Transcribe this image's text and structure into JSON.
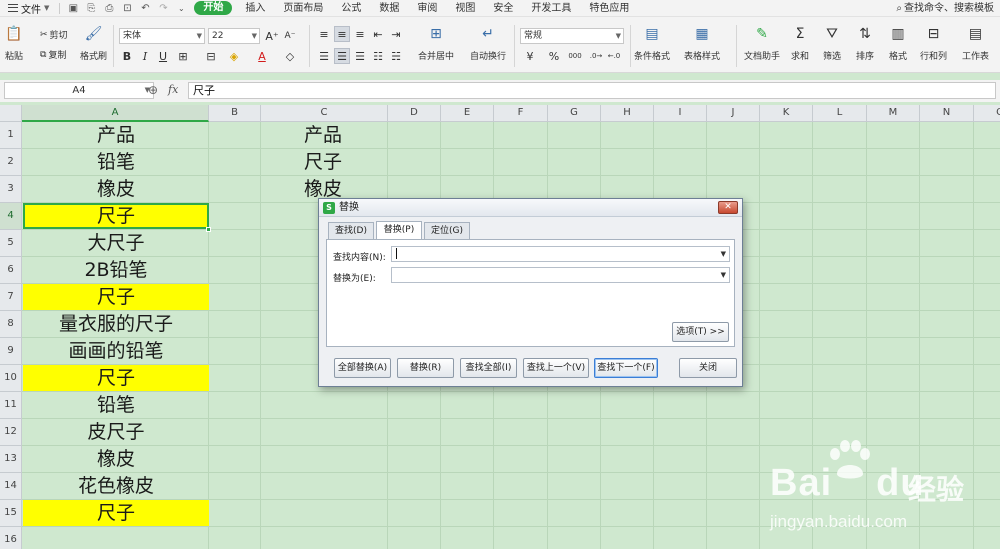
{
  "menubar": {
    "file_label": "文件",
    "tabs": [
      "开始",
      "插入",
      "页面布局",
      "公式",
      "数据",
      "审阅",
      "视图",
      "安全",
      "开发工具",
      "特色应用"
    ],
    "active_tab": "开始",
    "search_label": "查找命令、搜索模板"
  },
  "ribbon": {
    "paste": "粘贴",
    "cut": "剪切",
    "copy": "复制",
    "format_painter": "格式刷",
    "font_name": "宋体",
    "font_size": "22",
    "merge_center": "合并居中",
    "wrap_text": "自动换行",
    "number_format": "常规",
    "conditional_format": "条件格式",
    "table_style": "表格样式",
    "doc_helper": "文档助手",
    "sum": "求和",
    "filter": "筛选",
    "sort": "排序",
    "format": "格式",
    "rows_cols": "行和列",
    "worksheet": "工作表",
    "percent": "%",
    "thousands": "000"
  },
  "formula_bar": {
    "cell_ref": "A4",
    "fx": "fx",
    "content": "尺子"
  },
  "grid": {
    "columns": [
      "A",
      "B",
      "C",
      "D",
      "E",
      "F",
      "G",
      "H",
      "I",
      "J",
      "K",
      "L",
      "M",
      "N",
      "O"
    ],
    "rows": [
      "1",
      "2",
      "3",
      "4",
      "5",
      "6",
      "7",
      "8",
      "9",
      "10",
      "11",
      "12",
      "13",
      "14",
      "15",
      "16"
    ],
    "colA": [
      "产品",
      "铅笔",
      "橡皮",
      "尺子",
      "大尺子",
      "2B铅笔",
      "尺子",
      "量衣服的尺子",
      "画画的铅笔",
      "尺子",
      "铅笔",
      "皮尺子",
      "橡皮",
      "花色橡皮",
      "尺子",
      ""
    ],
    "colA_highlight": [
      false,
      false,
      false,
      true,
      false,
      false,
      true,
      false,
      false,
      true,
      false,
      false,
      false,
      false,
      true,
      false
    ],
    "colC": [
      "产品",
      "尺子",
      "橡皮"
    ],
    "highlight_color": "#ffff00",
    "selected_cell": "A4"
  },
  "dialog": {
    "title": "替换",
    "tabs": [
      "查找(D)",
      "替换(P)",
      "定位(G)"
    ],
    "active_tab": "替换(P)",
    "find_label": "查找内容(N):",
    "find_value": "",
    "replace_label": "替换为(E):",
    "replace_value": "",
    "options_button": "选项(T) >>",
    "buttons": [
      "全部替换(A)",
      "替换(R)",
      "查找全部(I)",
      "查找上一个(V)",
      "查找下一个(F)",
      "关闭"
    ]
  },
  "watermark": {
    "brand": "Bai",
    "brand_mid": "du",
    "brand_cn": "经验",
    "url": "jingyan.baidu.com"
  },
  "colors": {
    "accent": "#2fa847",
    "sheet_bg": "#cfe8cf"
  }
}
